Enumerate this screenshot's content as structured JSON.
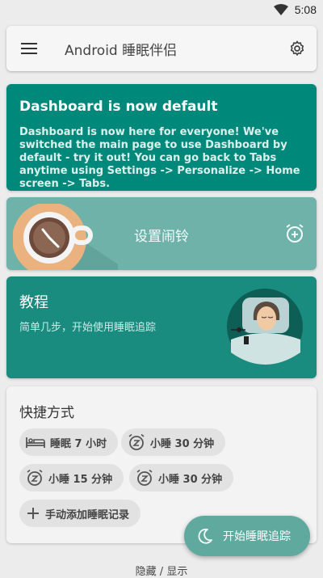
{
  "status_bar": {
    "time": "5:08"
  },
  "toolbar": {
    "title": "Android 睡眠伴侣"
  },
  "banner": {
    "title": "Dashboard is now default",
    "text": "Dashboard is now here for everyone! We've switched the main page to use Dashboard by default - try it out! You can go back to Tabs anytime using Settings -> Personalize -> Home screen -> Tabs."
  },
  "alarm_card": {
    "label": "设置闹铃"
  },
  "tutorial_card": {
    "title": "教程",
    "subtitle": "简单几步，开始使用睡眠追踪"
  },
  "shortcuts": {
    "title": "快捷方式",
    "items": [
      {
        "label": "睡眠 7 小时",
        "icon": "bed-icon"
      },
      {
        "label": "小睡 30 分钟",
        "icon": "snooze-icon"
      },
      {
        "label": "小睡 15 分钟",
        "icon": "snooze-icon"
      },
      {
        "label": "小睡 30 分钟",
        "icon": "snooze-icon"
      },
      {
        "label": "手动添加睡眠记录",
        "icon": "plus-icon"
      }
    ]
  },
  "fab": {
    "label": "开始睡眠追踪"
  },
  "footer": {
    "label": "隐藏 / 显示"
  },
  "colors": {
    "teal": "#00897b",
    "teal_light": "#6fb2aa",
    "fab": "#5fa99e"
  }
}
